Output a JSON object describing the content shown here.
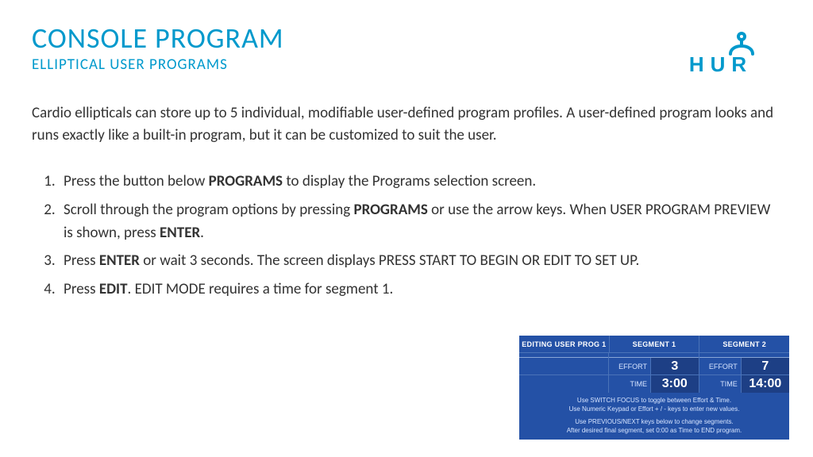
{
  "header": {
    "title": "CONSOLE PROGRAM",
    "subtitle": "ELLIPTICAL USER PROGRAMS",
    "logo_text": "HUR"
  },
  "intro": "Cardio ellipticals can store up to 5 individual, modifiable user-defined program profiles. A user-defined program looks and runs exactly like a built-in program, but it can be customized to suit the user.",
  "steps": [
    {
      "pre": "Press the button below ",
      "b1": "PROGRAMS",
      "post1": " to display the Programs selection screen."
    },
    {
      "pre": "Scroll through the program options by pressing ",
      "b1": "PROGRAMS",
      "post1": " or use the arrow keys. When USER PROGRAM PREVIEW is shown, press ",
      "b2": "ENTER",
      "post2": "."
    },
    {
      "pre": "Press ",
      "b1": "ENTER",
      "post1": " or wait 3 seconds. The screen displays PRESS START TO BEGIN OR EDIT TO SET UP."
    },
    {
      "pre": "Press ",
      "b1": "EDIT",
      "post1": ". EDIT MODE requires a time for segment 1."
    }
  ],
  "panel": {
    "tabs": [
      "EDITING USER PROG 1",
      "SEGMENT 1",
      "SEGMENT 2"
    ],
    "rows": {
      "effort_label": "EFFORT",
      "time_label": "TIME",
      "seg1": {
        "effort": "3",
        "time": "3:00"
      },
      "seg2": {
        "effort": "7",
        "time": "14:00"
      }
    },
    "footer1": "Use SWITCH FOCUS to toggle between Effort & Time.",
    "footer2": "Use Numeric Keypad or Effort + / - keys to enter new values.",
    "footer3": "Use PREVIOUS/NEXT keys below to change segments.",
    "footer4": "After desired final segment, set 0:00 as Time to END program."
  }
}
